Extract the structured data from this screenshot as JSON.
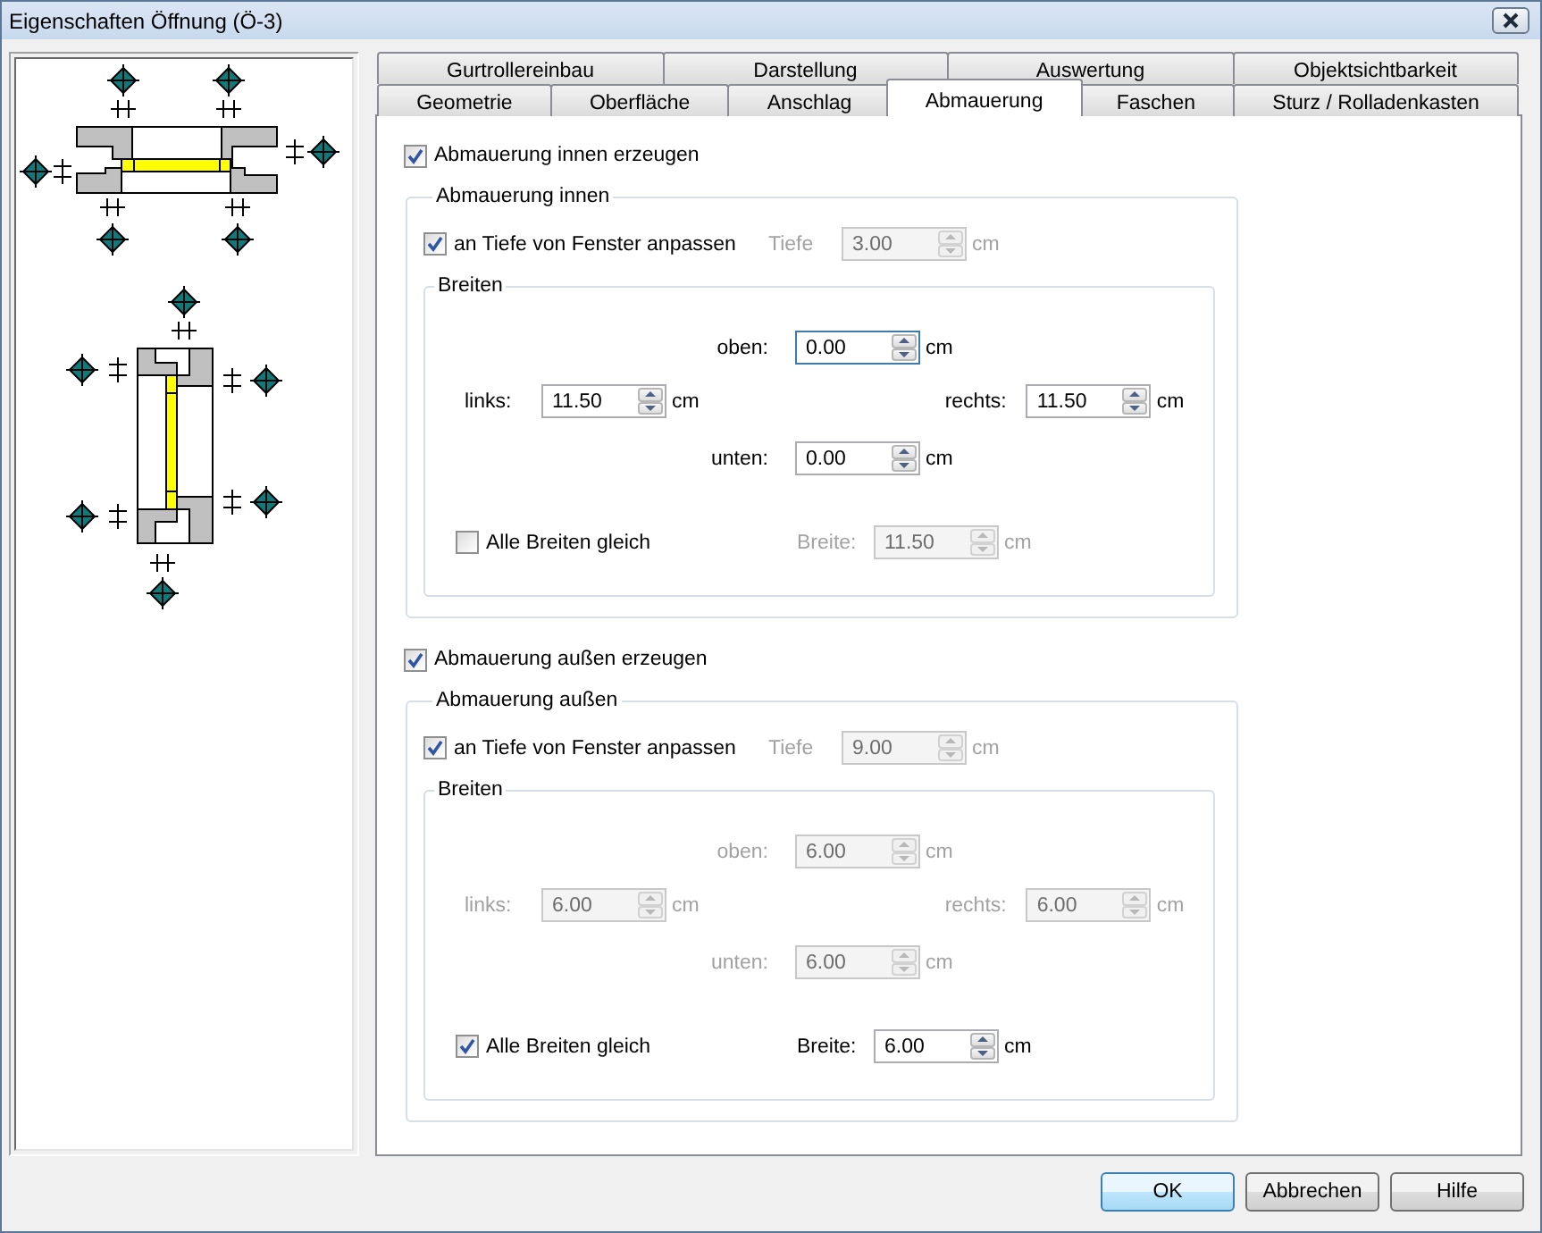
{
  "window": {
    "title": "Eigenschaften Öffnung (Ö-3)"
  },
  "tab_rows": [
    {
      "tabs": [
        {
          "label": "Gurtrollereinbau",
          "selected": false
        },
        {
          "label": "Darstellung",
          "selected": false
        },
        {
          "label": "Auswertung",
          "selected": false
        },
        {
          "label": "Objektsichtbarkeit",
          "selected": false
        }
      ]
    },
    {
      "tabs": [
        {
          "label": "Geometrie",
          "selected": false
        },
        {
          "label": "Oberfläche",
          "selected": false
        },
        {
          "label": "Anschlag",
          "selected": false
        },
        {
          "label": "Abmauerung",
          "selected": true
        },
        {
          "label": "Faschen",
          "selected": false
        },
        {
          "label": "Sturz / Rolladenkasten",
          "selected": false
        }
      ]
    }
  ],
  "sections": [
    {
      "enable": {
        "label": "Abmauerung innen erzeugen",
        "checked": true
      },
      "group_title": "Abmauerung innen",
      "fit_depth": {
        "label": "an Tiefe von Fenster anpassen",
        "checked": true
      },
      "depth": {
        "label": "Tiefe",
        "value": "3.00",
        "unit": "cm",
        "disabled": true,
        "focused": false
      },
      "widths": {
        "title": "Breiten",
        "top": {
          "label": "oben:",
          "value": "0.00",
          "unit": "cm",
          "disabled": false,
          "focused": true
        },
        "left": {
          "label": "links:",
          "value": "11.50",
          "unit": "cm",
          "disabled": false,
          "focused": false
        },
        "right": {
          "label": "rechts:",
          "value": "11.50",
          "unit": "cm",
          "disabled": false,
          "focused": false
        },
        "bottom": {
          "label": "unten:",
          "value": "0.00",
          "unit": "cm",
          "disabled": false,
          "focused": false
        },
        "all_equal": {
          "label": "Alle Breiten gleich",
          "checked": false
        },
        "width": {
          "label": "Breite:",
          "value": "11.50",
          "unit": "cm",
          "disabled": true,
          "focused": false
        }
      }
    },
    {
      "enable": {
        "label": "Abmauerung außen erzeugen",
        "checked": true
      },
      "group_title": "Abmauerung außen",
      "fit_depth": {
        "label": "an Tiefe von Fenster anpassen",
        "checked": true
      },
      "depth": {
        "label": "Tiefe",
        "value": "9.00",
        "unit": "cm",
        "disabled": true,
        "focused": false
      },
      "widths": {
        "title": "Breiten",
        "top": {
          "label": "oben:",
          "value": "6.00",
          "unit": "cm",
          "disabled": true,
          "focused": false
        },
        "left": {
          "label": "links:",
          "value": "6.00",
          "unit": "cm",
          "disabled": true,
          "focused": false
        },
        "right": {
          "label": "rechts:",
          "value": "6.00",
          "unit": "cm",
          "disabled": true,
          "focused": false
        },
        "bottom": {
          "label": "unten:",
          "value": "6.00",
          "unit": "cm",
          "disabled": true,
          "focused": false
        },
        "all_equal": {
          "label": "Alle Breiten gleich",
          "checked": true
        },
        "width": {
          "label": "Breite:",
          "value": "6.00",
          "unit": "cm",
          "disabled": false,
          "focused": false
        }
      }
    }
  ],
  "buttons": [
    {
      "label": "OK",
      "default": true
    },
    {
      "label": "Abbrechen",
      "default": false
    },
    {
      "label": "Hilfe",
      "default": false
    }
  ]
}
